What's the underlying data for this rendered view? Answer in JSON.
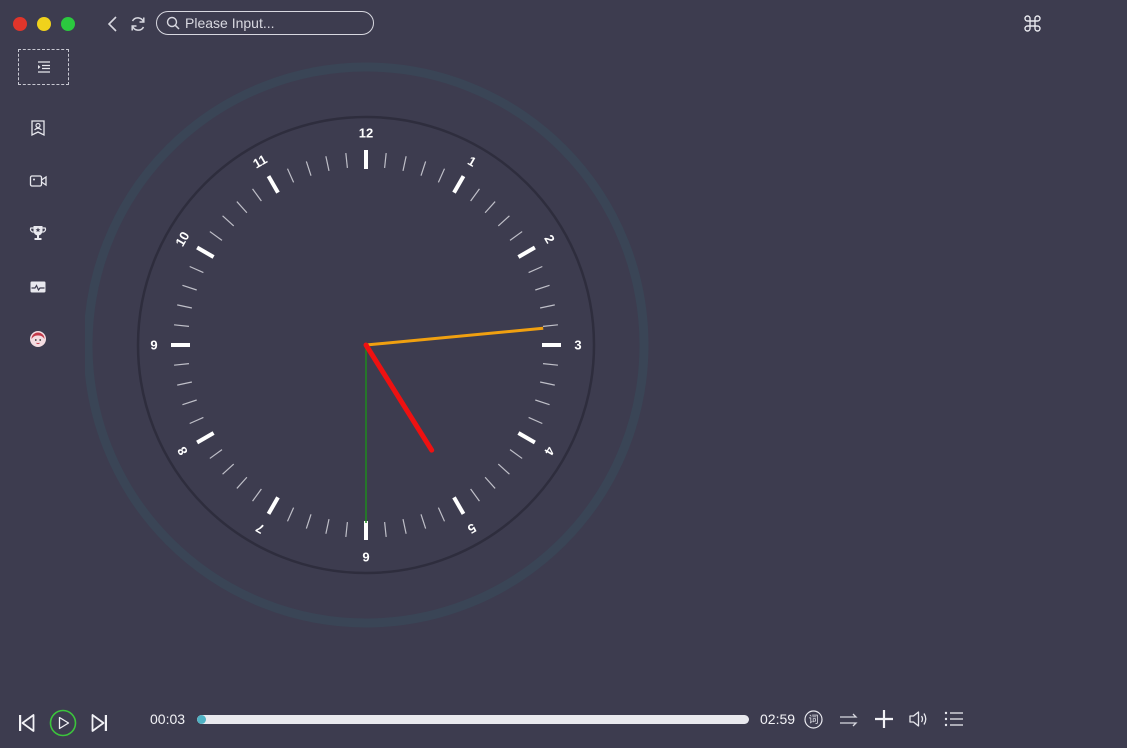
{
  "window": {
    "controls": [
      "close",
      "minimize",
      "maximize"
    ]
  },
  "toolbar": {
    "back_icon": "chevron-left-icon",
    "refresh_icon": "refresh-icon",
    "search": {
      "placeholder": "Please Input...",
      "value": ""
    },
    "command_icon": "command-icon"
  },
  "sidebar": {
    "toggle_icon": "indent-menu-icon",
    "items": [
      {
        "icon": "bookmark-user-icon"
      },
      {
        "icon": "video-camera-icon"
      },
      {
        "icon": "trophy-icon"
      },
      {
        "icon": "card-pulse-icon"
      },
      {
        "icon": "avatar-icon"
      }
    ]
  },
  "clock": {
    "numerals": [
      "12",
      "1",
      "2",
      "3",
      "4",
      "5",
      "6",
      "7",
      "8",
      "9",
      "10",
      "11"
    ],
    "hour_hand_value": 5.0,
    "minute_hand_value": 14.1,
    "second_hand_value": 30,
    "colors": {
      "hour_hand": "#ee1111",
      "minute_hand": "#f0a010",
      "second_hand": "#1f8a1f",
      "face_ring": "#2e2d3d",
      "halo": "#3a4556",
      "ticks": "#ffffff"
    }
  },
  "player": {
    "current_time": "00:03",
    "duration": "02:59",
    "progress_fraction": 0.017,
    "lyrics_badge": "词",
    "controls": {
      "prev_icon": "skip-previous-icon",
      "play_icon": "play-icon",
      "next_icon": "skip-next-icon",
      "mode_icon": "sequential-play-icon",
      "add_icon": "plus-icon",
      "volume_icon": "volume-icon",
      "playlist_icon": "playlist-icon"
    },
    "colors": {
      "play_ring": "#3cc43c",
      "progress_fill": "#4fb2c4",
      "progress_track": "#e9e9ee"
    }
  }
}
